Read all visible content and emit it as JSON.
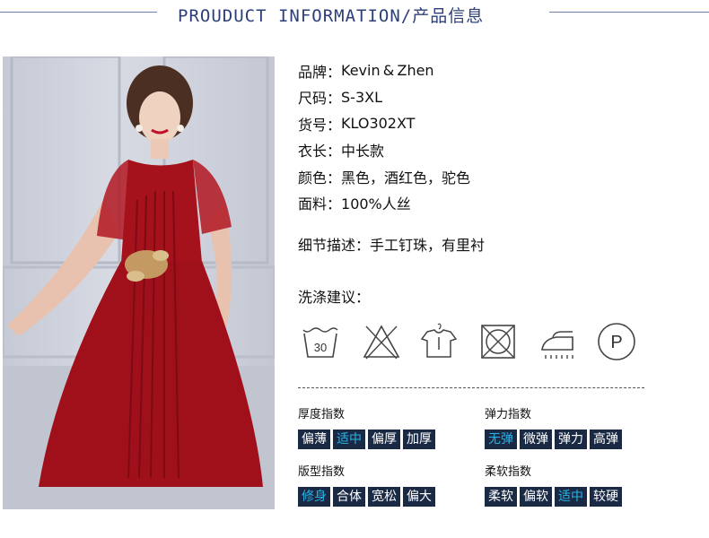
{
  "header": {
    "title": "PROUDUCT INFORMATION/产品信息"
  },
  "specs": [
    {
      "key": "品牌：",
      "value": "Kevin & Zhen"
    },
    {
      "key": "尺码：",
      "value": "S-3XL"
    },
    {
      "key": "货号：",
      "value": "KLO302XT"
    },
    {
      "key": "衣长：",
      "value": "中长款"
    },
    {
      "key": "颜色：",
      "value": "黑色，酒红色，驼色"
    },
    {
      "key": "面料：",
      "value": "100%人丝"
    }
  ],
  "detail": {
    "key": "细节描述：",
    "value": "手工钉珠，有里衬"
  },
  "washing": {
    "title": "洗涤建议：",
    "wash_temp": "30",
    "icons": [
      "wash-30-icon",
      "no-bleach-icon",
      "hang-dry-icon",
      "no-tumble-dry-icon",
      "iron-icon",
      "dry-clean-p-icon"
    ],
    "dry_clean_letter": "P"
  },
  "indices": {
    "thickness": {
      "title": "厚度指数",
      "options": [
        "偏薄",
        "适中",
        "偏厚",
        "加厚"
      ],
      "selected": "适中"
    },
    "elasticity": {
      "title": "弹力指数",
      "options": [
        "无弹",
        "微弹",
        "弹力",
        "高弹"
      ],
      "selected": "无弹"
    },
    "fit": {
      "title": "版型指数",
      "options": [
        "修身",
        "合体",
        "宽松",
        "偏大"
      ],
      "selected": "修身"
    },
    "softness": {
      "title": "柔软指数",
      "options": [
        "柔软",
        "偏软",
        "适中",
        "较硬"
      ],
      "selected": "适中"
    }
  },
  "colors": {
    "accent": "#27b1e6",
    "chip_bg": "#1b2a44",
    "header": "#2c3f79",
    "dress": "#a5121c"
  }
}
